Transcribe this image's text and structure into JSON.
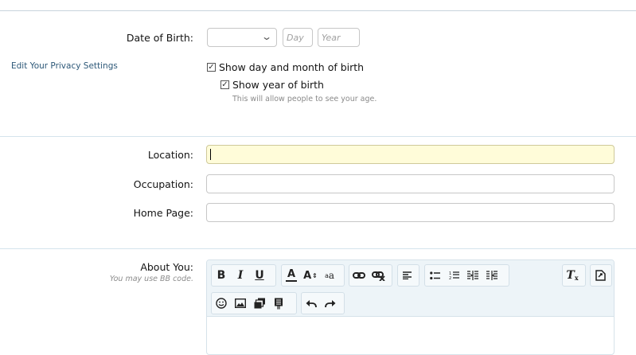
{
  "birth": {
    "label": "Date of Birth:",
    "month_selected": "",
    "day_placeholder": "Day",
    "year_placeholder": "Year",
    "privacy_link": "Edit Your Privacy Settings",
    "show_day_month": "Show day and month of birth",
    "show_year": "Show year of birth",
    "hint": "This will allow people to see your age."
  },
  "fields": {
    "location_label": "Location:",
    "location_value": "",
    "occupation_label": "Occupation:",
    "occupation_value": "",
    "homepage_label": "Home Page:",
    "homepage_value": ""
  },
  "about": {
    "label": "About You:",
    "sublabel": "You may use BB code.",
    "toolbar": {
      "bold": "B",
      "italic": "I",
      "underline": "U",
      "font_color": "A",
      "font_size": "A",
      "font_family": "a",
      "icons_row1": [
        "bold-icon",
        "italic-icon",
        "underline-icon",
        "font-color-icon",
        "font-size-icon",
        "font-family-icon",
        "link-icon",
        "unlink-icon",
        "align-icon",
        "bullet-list-icon",
        "numbered-list-icon",
        "outdent-icon",
        "indent-icon",
        "remove-format-icon",
        "toggle-bbcode-icon"
      ],
      "icons_row2": [
        "smiley-icon",
        "image-icon",
        "media-icon",
        "insert-more-icon",
        "undo-icon",
        "redo-icon"
      ]
    }
  }
}
